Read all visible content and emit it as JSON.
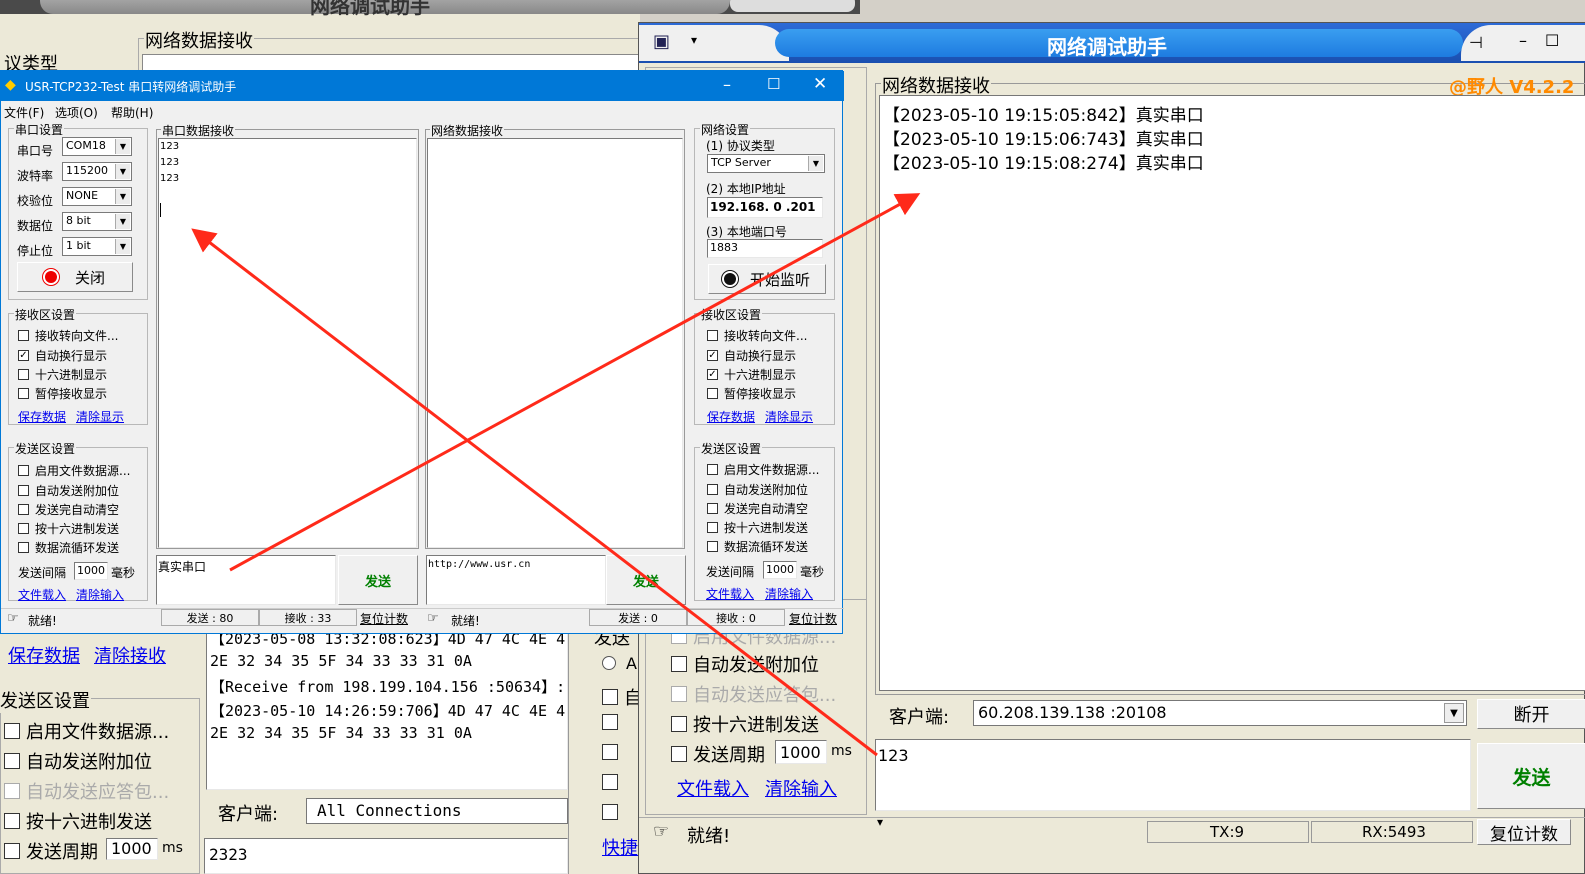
{
  "bg_win": {
    "title": "网络调试助手",
    "proto_label": "议类型",
    "recv_group": "网络数据接收",
    "lines": [
      "【2023-05-08 13:32:08:623】4D 47 4C 4E 4",
      "2E 32 34 35 5F 34 33 33 31 0A",
      "【Receive from 198.199.104.156 :50634】:",
      "【2023-05-10 14:26:59:706】4D 47 4C 4E 4",
      "2E 32 34 35 5F 34 33 33 31 0A"
    ],
    "save_link": "保存数据",
    "clear_link": "清除接收",
    "send_group": "发送区设置",
    "send_opts": [
      "启用文件数据源...",
      "自动发送附加位",
      "自动发送应答包...",
      "按十六进制发送",
      "发送周期"
    ],
    "period_value": "1000",
    "period_unit": "ms",
    "client_label": "客户端:",
    "client_value": "All Connections",
    "input_value": "2323",
    "fragments": {
      "send_frag": "发送",
      "a_frag": "A",
      "auto_frag": "自",
      "quick": "快捷"
    }
  },
  "right_win": {
    "title": "网络调试助手",
    "recv_group": "网络数据接收",
    "version": "@野人 V4.2.2",
    "lines": [
      "【2023-05-10 19:15:05:842】真实串口",
      "【2023-05-10 19:15:06:743】真实串口",
      "【2023-05-10 19:15:08:274】真实串口"
    ],
    "opts": [
      {
        "label": "自动发送附加位",
        "checked": false,
        "disabled": false
      },
      {
        "label": "自动发送应答包...",
        "checked": false,
        "disabled": true
      },
      {
        "label": "按十六进制发送",
        "checked": false,
        "disabled": false
      },
      {
        "label": "发送周期",
        "checked": false,
        "disabled": false
      }
    ],
    "top_opt": "启用文件数据源...",
    "period_value": "1000",
    "period_unit": "ms",
    "file_link": "文件载入",
    "clear_link": "清除输入",
    "client_label": "客户端:",
    "client_value": "60.208.139.138 :20108",
    "disconnect": "断开",
    "input_value": "123",
    "send": "发送",
    "status": "就绪!",
    "tx": "TX:9",
    "rx": "RX:5493",
    "reset": "复位计数"
  },
  "usr": {
    "title": "USR-TCP232-Test 串口转网络调试助手",
    "menu": [
      "文件(F)",
      "选项(O)",
      "帮助(H)"
    ],
    "serial_group": "串口设置",
    "serial_fields": [
      {
        "label": "串口号",
        "value": "COM18"
      },
      {
        "label": "波特率",
        "value": "115200"
      },
      {
        "label": "校验位",
        "value": "NONE"
      },
      {
        "label": "数据位",
        "value": "8 bit"
      },
      {
        "label": "停止位",
        "value": "1 bit"
      }
    ],
    "close_btn": "关闭",
    "recv_group": "接收区设置",
    "recv_opts": [
      {
        "label": "接收转向文件...",
        "checked": false
      },
      {
        "label": "自动换行显示",
        "checked": true
      },
      {
        "label": "十六进制显示",
        "checked": false
      },
      {
        "label": "暂停接收显示",
        "checked": false
      }
    ],
    "save_link": "保存数据",
    "clear_link": "清除显示",
    "send_group": "发送区设置",
    "send_opts": [
      {
        "label": "启用文件数据源...",
        "checked": false
      },
      {
        "label": "自动发送附加位",
        "checked": false
      },
      {
        "label": "发送完自动清空",
        "checked": false
      },
      {
        "label": "按十六进制发送",
        "checked": false
      },
      {
        "label": "数据流循环发送",
        "checked": false
      }
    ],
    "interval_label": "发送间隔",
    "interval_value": "1000",
    "interval_unit": "毫秒",
    "file_link": "文件载入",
    "clear_input_link": "清除输入",
    "serial_recv_title": "串口数据接收",
    "serial_lines": [
      "123",
      "123",
      "123"
    ],
    "net_recv_title": "网络数据接收",
    "serial_input": "真实串口",
    "net_input": "http://www.usr.cn",
    "send": "发送",
    "net_group": "网络设置",
    "proto_label": "(1) 协议类型",
    "proto_value": "TCP Server",
    "ip_label": "(2) 本地IP地址",
    "ip_value": "192.168. 0 .201",
    "port_label": "(3) 本地端口号",
    "port_value": "1883",
    "listen_btn": "开始监听",
    "net_recv_group": "接收区设置",
    "net_recv_opts": [
      {
        "label": "接收转向文件...",
        "checked": false
      },
      {
        "label": "自动换行显示",
        "checked": true
      },
      {
        "label": "十六进制显示",
        "checked": true
      },
      {
        "label": "暂停接收显示",
        "checked": false
      }
    ],
    "net_send_group": "发送区设置",
    "status_left": "就绪!",
    "sent_left": "发送 : 80",
    "recv_left": "接收 : 33",
    "reset": "复位计数",
    "status_right": "就绪!",
    "sent_right": "发送 : 0",
    "recv_right": "接收 : 0",
    "check_mark": "✓",
    "colors": {
      "titlebar": "#0078d7",
      "arrow": "#ff2a1a",
      "send_green": "#008000",
      "link": "#0000ee"
    }
  }
}
